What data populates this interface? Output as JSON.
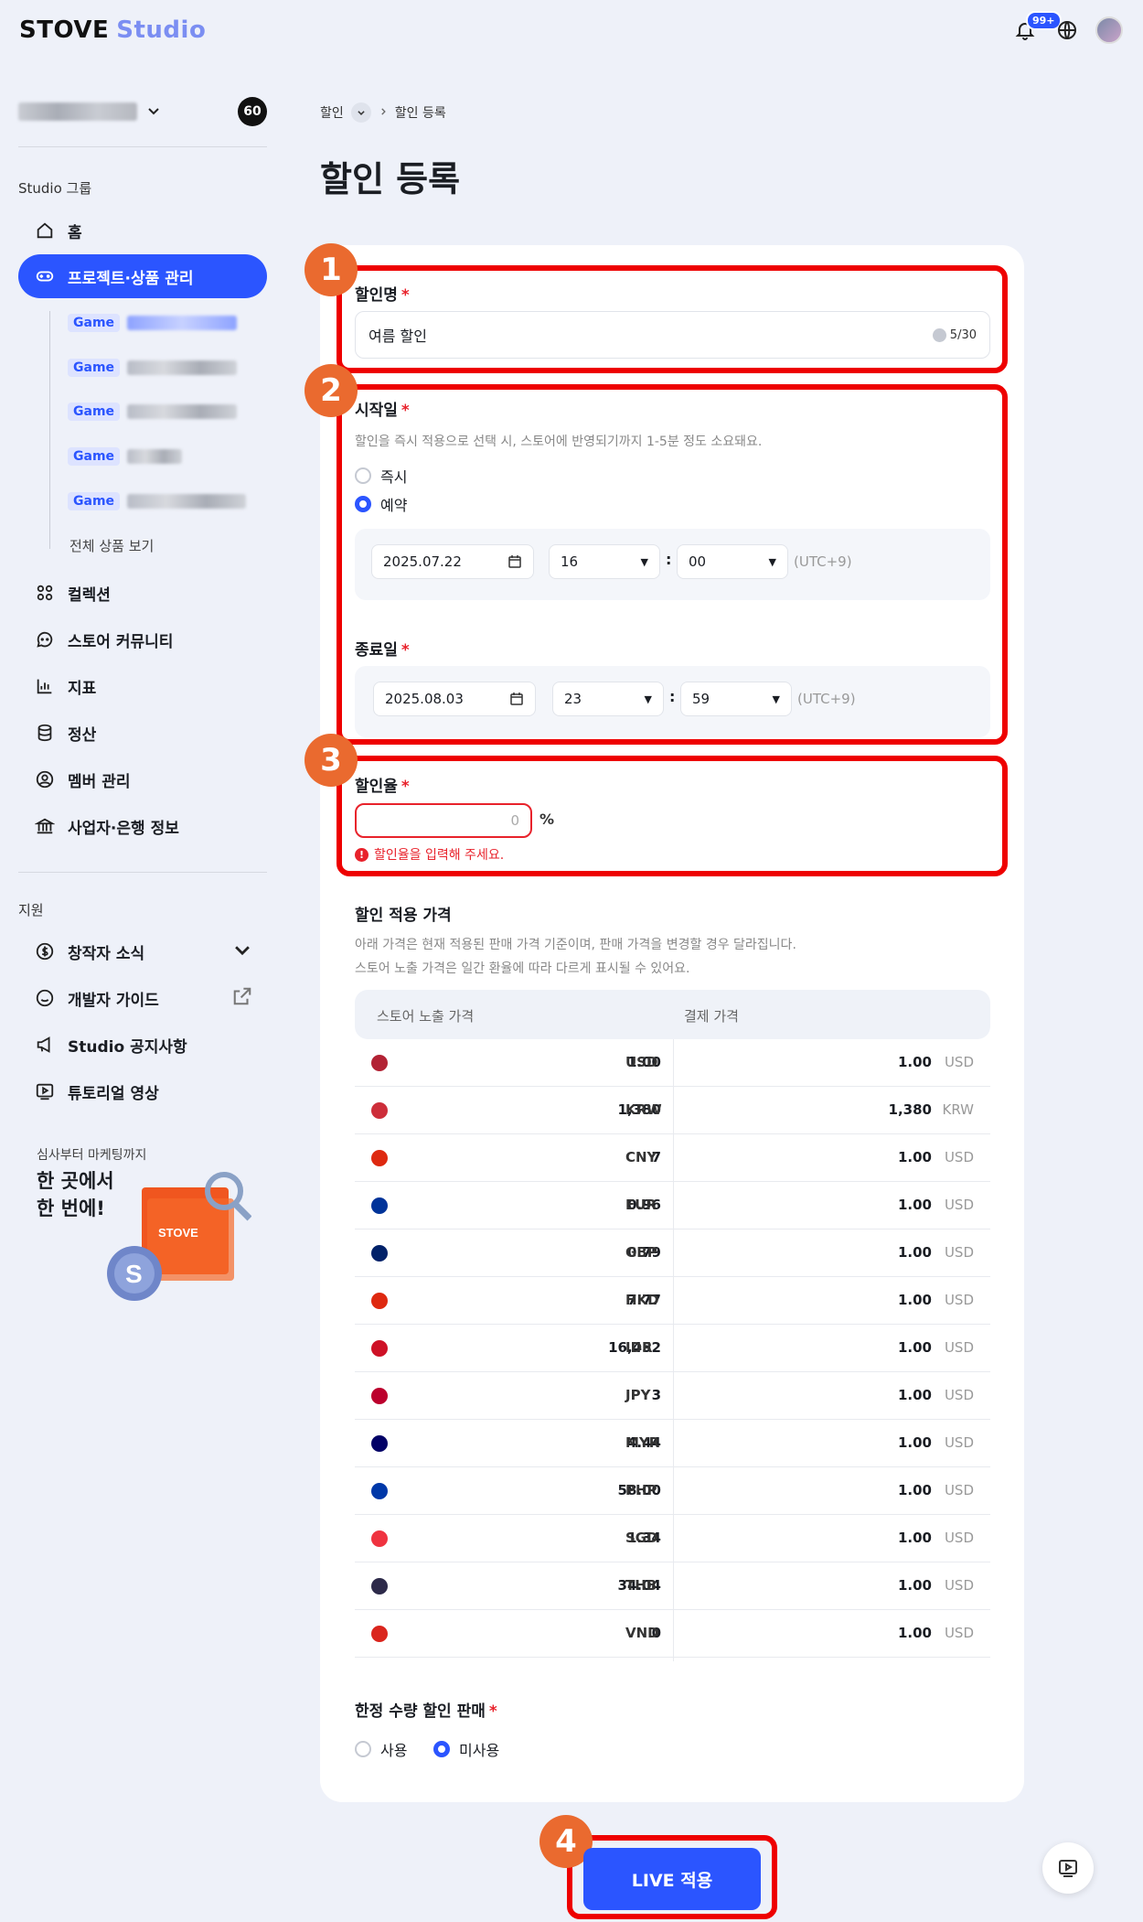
{
  "header": {
    "logo_brand": "STOVE",
    "logo_product": "Studio",
    "notification_badge": "99+"
  },
  "sidebar": {
    "project_count": "60",
    "section_studio": "Studio 그룹",
    "items": [
      {
        "label": "홈",
        "icon": "home-icon"
      },
      {
        "label": "프로젝트·상품 관리",
        "icon": "gamepad-icon",
        "active": true
      },
      {
        "label": "컬렉션",
        "icon": "grid-icon"
      },
      {
        "label": "스토어 커뮤니티",
        "icon": "chat-icon"
      },
      {
        "label": "지표",
        "icon": "chart-icon"
      },
      {
        "label": "정산",
        "icon": "database-icon"
      },
      {
        "label": "멤버 관리",
        "icon": "user-icon"
      },
      {
        "label": "사업자·은행 정보",
        "icon": "bank-icon"
      }
    ],
    "sub_items": [
      "Game",
      "Game",
      "Game",
      "Game",
      "Game"
    ],
    "all_products": "전체 상품 보기",
    "section_support": "지원",
    "support_items": [
      {
        "label": "창작자 소식",
        "icon": "dollar-circle-icon"
      },
      {
        "label": "개발자 가이드",
        "icon": "smile-icon"
      },
      {
        "label": "Studio 공지사항",
        "icon": "megaphone-icon"
      },
      {
        "label": "튜토리얼 영상",
        "icon": "video-icon"
      }
    ],
    "promo_sub": "심사부터 마케팅까지",
    "promo_line1": "한 곳에서",
    "promo_line2": "한 번에!",
    "promo_box_label": "STOVE"
  },
  "breadcrumb": {
    "parent": "할인",
    "current": "할인 등록"
  },
  "page_title": "할인 등록",
  "form": {
    "name_label": "할인명",
    "name_value": "여름 할인",
    "name_count": "5/30",
    "start_label": "시작일",
    "start_hint": "할인을 즉시 적용으로 선택 시, 스토어에 반영되기까지 1-5분 정도 소요돼요.",
    "radio_immediate": "즉시",
    "radio_reserve": "예약",
    "start_date": "2025.07.22",
    "start_hour": "16",
    "start_min": "00",
    "timezone": "(UTC+9)",
    "end_label": "종료일",
    "end_date": "2025.08.03",
    "end_hour": "23",
    "end_min": "59",
    "rate_label": "할인율",
    "rate_placeholder": "0",
    "rate_unit": "%",
    "rate_error": "할인율을 입력해 주세요.",
    "price_label": "할인 적용 가격",
    "price_hint1": "아래 가격은 현재 적용된 판매 가격 기준이며, 판매 가격을 변경할 경우 달라집니다.",
    "price_hint2": "스토어 노출 가격은 일간 환율에 따라 다르게 표시될 수 있어요.",
    "col_store": "스토어 노출 가격",
    "col_pay": "결제 가격",
    "limited_label": "한정 수량 할인 판매",
    "limited_use": "사용",
    "limited_nouse": "미사용"
  },
  "prices": [
    {
      "flag": "#b22234",
      "v1": "1.00",
      "c1": "USD",
      "v2": "1.00",
      "c2": "USD"
    },
    {
      "flag": "#cd2e3a",
      "v1": "1,380",
      "c1": "KRW",
      "v2": "1,380",
      "c2": "KRW"
    },
    {
      "flag": "#de2910",
      "v1": "7",
      "c1": "CNY",
      "v2": "1.00",
      "c2": "USD"
    },
    {
      "flag": "#003399",
      "v1": "0.96",
      "c1": "EUR",
      "v2": "1.00",
      "c2": "USD"
    },
    {
      "flag": "#012169",
      "v1": "0.79",
      "c1": "GBP",
      "v2": "1.00",
      "c2": "USD"
    },
    {
      "flag": "#de2910",
      "v1": "7.77",
      "c1": "HKD",
      "v2": "1.00",
      "c2": "USD"
    },
    {
      "flag": "#ce1126",
      "v1": "16,452",
      "c1": "IDR",
      "v2": "1.00",
      "c2": "USD"
    },
    {
      "flag": "#bc002d",
      "v1": "3",
      "c1": "JPY",
      "v2": "1.00",
      "c2": "USD"
    },
    {
      "flag": "#010066",
      "v1": "4.44",
      "c1": "MYR",
      "v2": "1.00",
      "c2": "USD"
    },
    {
      "flag": "#0038a8",
      "v1": "58.00",
      "c1": "PHP",
      "v2": "1.00",
      "c2": "USD"
    },
    {
      "flag": "#ef3340",
      "v1": "1.34",
      "c1": "SGD",
      "v2": "1.00",
      "c2": "USD"
    },
    {
      "flag": "#2d2a4a",
      "v1": "34.04",
      "c1": "THB",
      "v2": "1.00",
      "c2": "USD"
    },
    {
      "flag": "#da251d",
      "v1": "0",
      "c1": "VND",
      "v2": "1.00",
      "c2": "USD"
    }
  ],
  "markers": [
    "1",
    "2",
    "3",
    "4"
  ],
  "live_button": "LIVE 적용",
  "colors": {
    "accent": "#2b55ff",
    "error": "#e8222b",
    "marker": "#ea6a2f",
    "highlight": "#e00000"
  }
}
